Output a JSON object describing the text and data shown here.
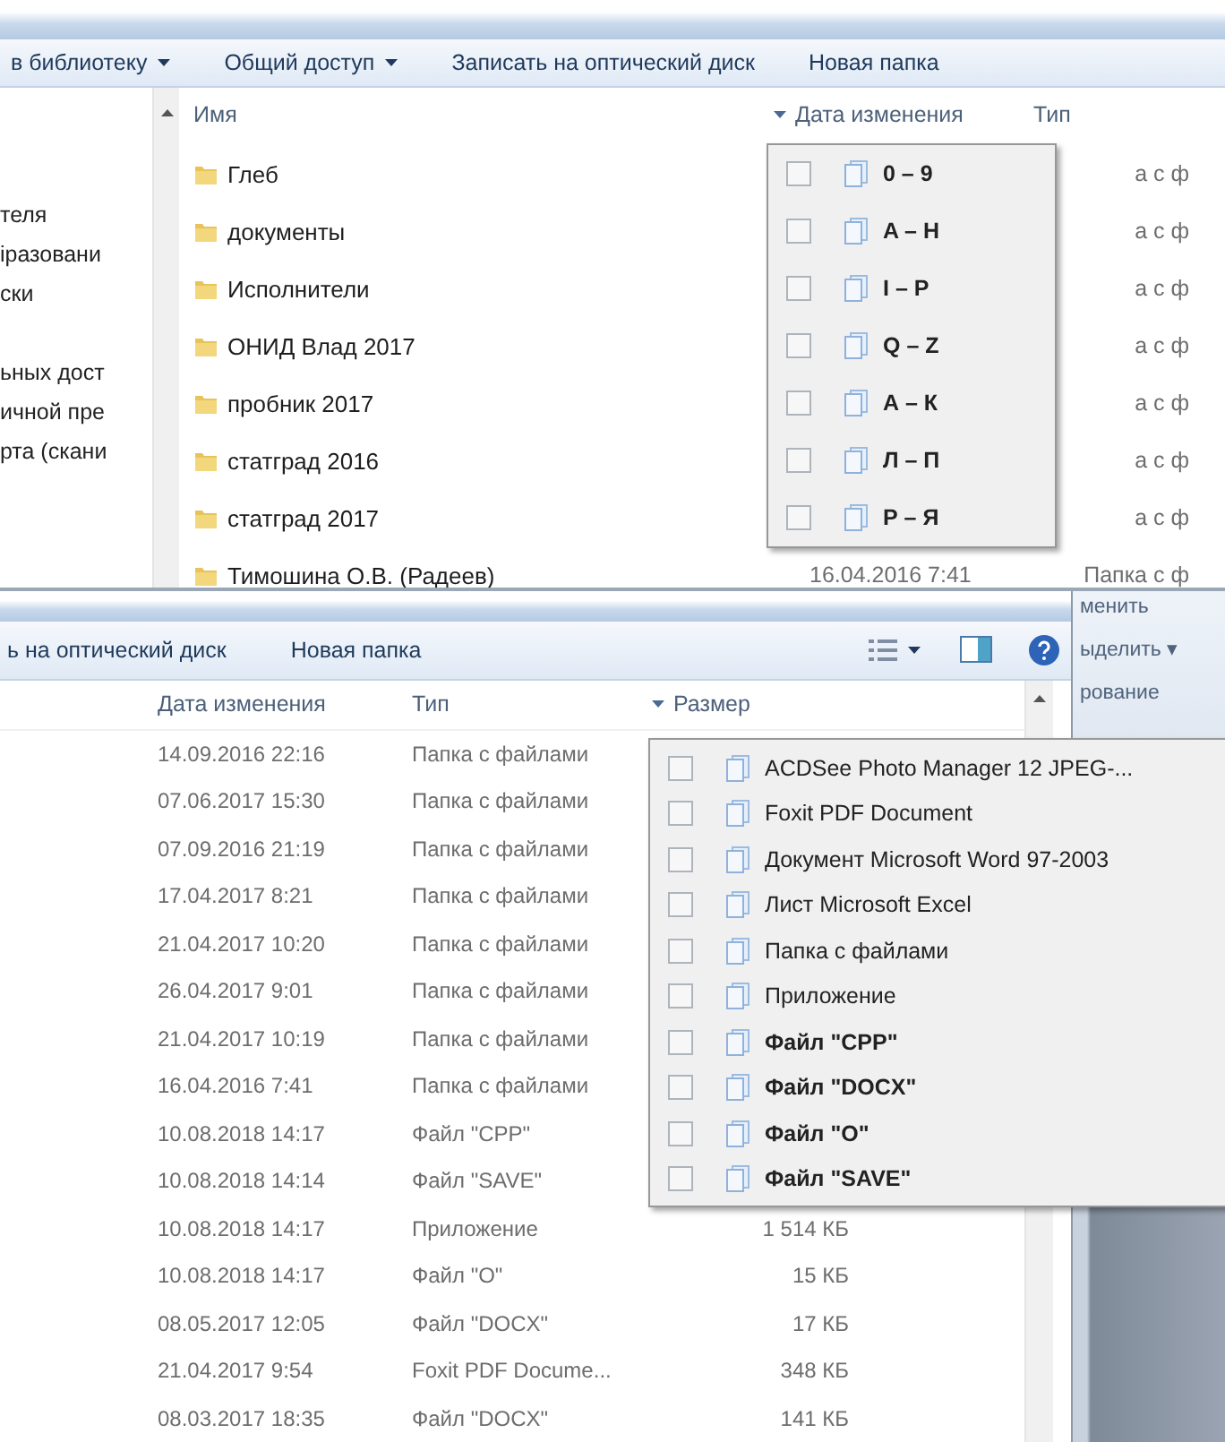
{
  "top_window": {
    "toolbar": [
      {
        "label": "в библиотеку",
        "has_menu": true
      },
      {
        "label": "Общий доступ",
        "has_menu": true
      },
      {
        "label": "Записать на оптический диск",
        "has_menu": false
      },
      {
        "label": "Новая папка",
        "has_menu": false
      }
    ],
    "nav_items": [
      {
        "label": "теля"
      },
      {
        "label": "іразовани"
      },
      {
        "label": "ски"
      },
      {
        "label": "ьных дост"
      },
      {
        "label": "ичной пре"
      },
      {
        "label": "рта (скани"
      }
    ],
    "columns": [
      {
        "label": "Имя",
        "filter": false
      },
      {
        "label": "Дата изменения",
        "filter": true
      },
      {
        "label": "Тип",
        "filter": false
      }
    ],
    "rows": [
      {
        "name": "Глеб",
        "type": "а с ф"
      },
      {
        "name": "документы",
        "type": "а с ф"
      },
      {
        "name": "Исполнители",
        "type": "а с ф"
      },
      {
        "name": "ОНИД  Влад 2017",
        "type": "а с ф"
      },
      {
        "name": "пробник 2017",
        "type": "а с ф"
      },
      {
        "name": "статград  2016",
        "type": "а с ф"
      },
      {
        "name": "статград 2017",
        "type": "а с ф"
      },
      {
        "name": "Тимошина О.В. (Радеев)",
        "date": "16.04.2016 7:41",
        "type": "Папка с ф"
      }
    ],
    "filter_menu": {
      "items": [
        {
          "label": "0 – 9",
          "checked": false,
          "bold": true
        },
        {
          "label": "A – H",
          "checked": false,
          "bold": true
        },
        {
          "label": "I – P",
          "checked": false,
          "bold": true
        },
        {
          "label": "Q – Z",
          "checked": false,
          "bold": true
        },
        {
          "label": "А – К",
          "checked": false,
          "bold": true
        },
        {
          "label": "Л – П",
          "checked": false,
          "bold": true
        },
        {
          "label": "Р – Я",
          "checked": false,
          "bold": true
        }
      ]
    }
  },
  "bottom_window": {
    "toolbar": [
      {
        "label": "ь на оптический диск",
        "has_menu": false
      },
      {
        "label": "Новая папка",
        "has_menu": false
      }
    ],
    "columns": [
      {
        "label": "Дата изменения",
        "filter": false
      },
      {
        "label": "Тип",
        "filter": false
      },
      {
        "label": "Размер",
        "filter": true
      }
    ],
    "rows": [
      {
        "date": "14.09.2016 22:16",
        "type": "Папка с файлами"
      },
      {
        "date": "07.06.2017 15:30",
        "type": "Папка с файлами"
      },
      {
        "date": "07.09.2016 21:19",
        "type": "Папка с файлами"
      },
      {
        "date": "17.04.2017 8:21",
        "type": "Папка с файлами"
      },
      {
        "date": "21.04.2017 10:20",
        "type": "Папка с файлами"
      },
      {
        "date": "26.04.2017 9:01",
        "type": "Папка с файлами"
      },
      {
        "date": "21.04.2017 10:19",
        "type": "Папка с файлами"
      },
      {
        "date": "16.04.2016 7:41",
        "type": "Папка с файлами"
      },
      {
        "date": "10.08.2018 14:17",
        "type": "Файл \"CPP\""
      },
      {
        "date": "10.08.2018 14:14",
        "type": "Файл \"SAVE\""
      },
      {
        "date": "10.08.2018 14:17",
        "type": "Приложение",
        "size": "1 514 КБ"
      },
      {
        "date": "10.08.2018 14:17",
        "type": "Файл \"O\"",
        "size": "15 КБ"
      },
      {
        "date": "08.05.2017 12:05",
        "type": "Файл \"DOCX\"",
        "size": "17 КБ"
      },
      {
        "date": "21.04.2017 9:54",
        "type": "Foxit PDF Docume...",
        "size": "348 КБ"
      },
      {
        "date": "08.03.2017 18:35",
        "type": "Файл \"DOCX\"",
        "size": "141 КБ"
      }
    ],
    "filter_menu": {
      "items": [
        {
          "label": "ACDSee Photo Manager 12 JPEG-...",
          "checked": false,
          "bold": false
        },
        {
          "label": "Foxit PDF Document",
          "checked": false,
          "bold": false
        },
        {
          "label": "Документ Microsoft Word 97-2003",
          "checked": false,
          "bold": false
        },
        {
          "label": "Лист Microsoft Excel",
          "checked": false,
          "bold": false
        },
        {
          "label": "Папка с файлами",
          "checked": false,
          "bold": false
        },
        {
          "label": "Приложение",
          "checked": false,
          "bold": false
        },
        {
          "label": "Файл \"CPP\"",
          "checked": false,
          "bold": true
        },
        {
          "label": "Файл \"DOCX\"",
          "checked": false,
          "bold": true
        },
        {
          "label": "Файл \"O\"",
          "checked": false,
          "bold": true
        },
        {
          "label": "Файл \"SAVE\"",
          "checked": false,
          "bold": true
        }
      ]
    }
  },
  "background_window": {
    "labels": [
      "менить",
      "ыделить ▾",
      "рование"
    ]
  }
}
